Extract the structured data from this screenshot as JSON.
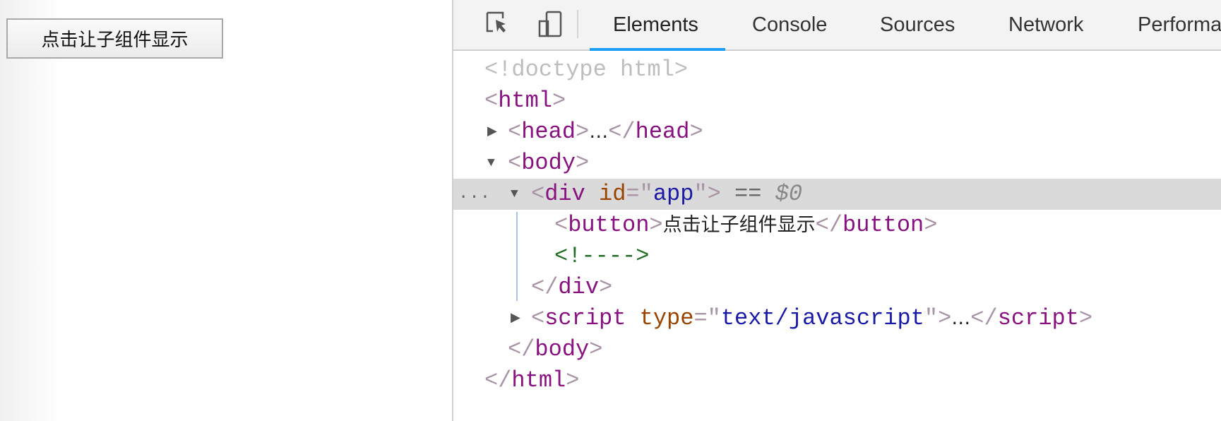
{
  "page": {
    "button_label": "点击让子组件显示"
  },
  "devtools": {
    "toolbar_icons": [
      "inspect-element-icon",
      "device-toggle-icon"
    ],
    "tabs": [
      {
        "label": "Elements",
        "active": true
      },
      {
        "label": "Console"
      },
      {
        "label": "Sources"
      },
      {
        "label": "Network"
      },
      {
        "label": "Performa"
      }
    ],
    "colors": {
      "accent": "#1a9ff4",
      "tag": "#881280",
      "attr_name": "#994500",
      "attr_value": "#1a1aa6",
      "comment": "#236e25",
      "selection": "#dadada"
    },
    "dom_tree": [
      {
        "indent": 0,
        "arrow": null,
        "tokens": [
          [
            "<!doctype html>",
            "dt"
          ]
        ]
      },
      {
        "indent": 0,
        "arrow": null,
        "tokens": [
          [
            "<",
            "br"
          ],
          [
            "html",
            "tag"
          ],
          [
            ">",
            "br"
          ]
        ]
      },
      {
        "indent": 1,
        "arrow": "collapsed",
        "tokens": [
          [
            "<",
            "br"
          ],
          [
            "head",
            "tag"
          ],
          [
            ">",
            "br"
          ],
          [
            "…",
            "tx"
          ],
          [
            "</",
            "br"
          ],
          [
            "head",
            "tag"
          ],
          [
            ">",
            "br"
          ]
        ]
      },
      {
        "indent": 1,
        "arrow": "expanded",
        "tokens": [
          [
            "<",
            "br"
          ],
          [
            "body",
            "tag"
          ],
          [
            ">",
            "br"
          ]
        ]
      },
      {
        "indent": 2,
        "arrow": "expanded",
        "selected": true,
        "dots": "...",
        "tokens": [
          [
            "<",
            "br"
          ],
          [
            "div",
            "tag"
          ],
          [
            " ",
            "tag"
          ],
          [
            "id",
            "an"
          ],
          [
            "=\"",
            "br"
          ],
          [
            "app",
            "av"
          ],
          [
            "\"",
            "br"
          ],
          [
            ">",
            "br"
          ],
          [
            " == ",
            "eq"
          ],
          [
            "$0",
            "ref"
          ]
        ]
      },
      {
        "indent": 3,
        "arrow": null,
        "tokens": [
          [
            "<",
            "br"
          ],
          [
            "button",
            "tag"
          ],
          [
            ">",
            "br"
          ],
          [
            "点击让子组件显示",
            "tx"
          ],
          [
            "</",
            "br"
          ],
          [
            "button",
            "tag"
          ],
          [
            ">",
            "br"
          ]
        ]
      },
      {
        "indent": 3,
        "arrow": null,
        "tokens": [
          [
            "<!---->",
            "cm"
          ]
        ]
      },
      {
        "indent": 2,
        "arrow": null,
        "tokens": [
          [
            "</",
            "br"
          ],
          [
            "div",
            "tag"
          ],
          [
            ">",
            "br"
          ]
        ]
      },
      {
        "indent": 2,
        "arrow": "collapsed",
        "tokens": [
          [
            "<",
            "br"
          ],
          [
            "script",
            "tag"
          ],
          [
            " ",
            "tag"
          ],
          [
            "type",
            "an"
          ],
          [
            "=\"",
            "br"
          ],
          [
            "text/javascript",
            "av"
          ],
          [
            "\"",
            "br"
          ],
          [
            ">",
            "br"
          ],
          [
            "…",
            "tx"
          ],
          [
            "</",
            "br"
          ],
          [
            "script",
            "tag"
          ],
          [
            ">",
            "br"
          ]
        ]
      },
      {
        "indent": 1,
        "arrow": null,
        "tokens": [
          [
            "</",
            "br"
          ],
          [
            "body",
            "tag"
          ],
          [
            ">",
            "br"
          ]
        ]
      },
      {
        "indent": 0,
        "arrow": null,
        "tokens": [
          [
            "</",
            "br"
          ],
          [
            "html",
            "tag"
          ],
          [
            ">",
            "br"
          ]
        ]
      }
    ]
  }
}
